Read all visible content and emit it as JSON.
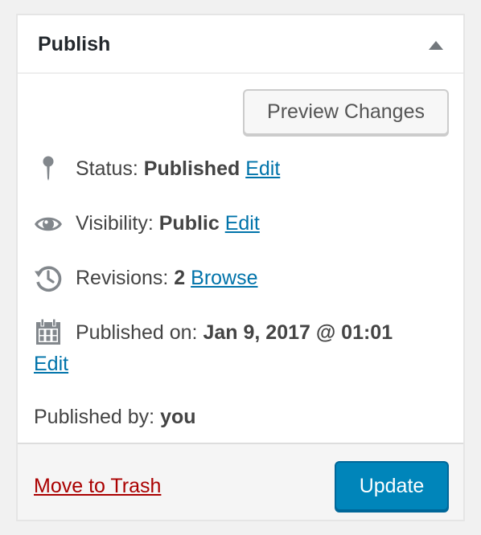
{
  "panel": {
    "title": "Publish",
    "toggle_icon": "triangle-up-icon"
  },
  "actions": {
    "preview_label": "Preview Changes"
  },
  "status": {
    "icon": "pin-icon",
    "label": "Status:",
    "value": "Published",
    "edit_label": "Edit"
  },
  "visibility": {
    "icon": "eye-icon",
    "label": "Visibility:",
    "value": "Public",
    "edit_label": "Edit"
  },
  "revisions": {
    "icon": "history-icon",
    "label": "Revisions:",
    "value": "2",
    "browse_label": "Browse"
  },
  "published_on": {
    "icon": "calendar-icon",
    "label": "Published on:",
    "value": "Jan 9, 2017 @ 01:01",
    "edit_label": "Edit"
  },
  "published_by": {
    "label": "Published by:",
    "value": "you"
  },
  "footer": {
    "trash_label": "Move to Trash",
    "update_label": "Update"
  },
  "colors": {
    "link": "#0073aa",
    "trash": "#a00",
    "primary_button": "#0085ba",
    "icon": "#82878c"
  }
}
